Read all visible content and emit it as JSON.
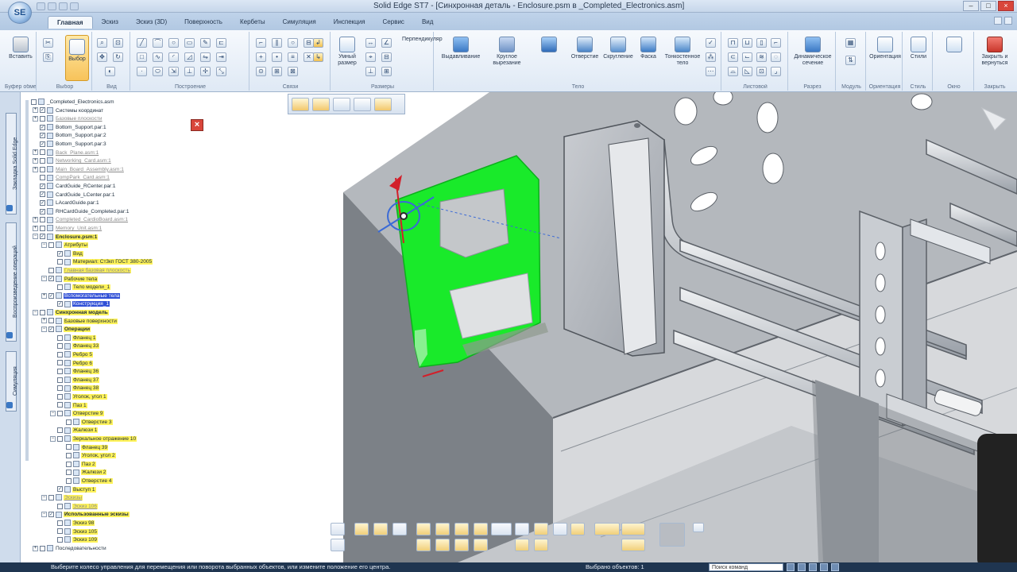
{
  "app": {
    "logo": "SE",
    "window_title": "Solid Edge ST7 - [Синхронная деталь - Enclosure.psm в _Completed_Electronics.asm]"
  },
  "tabs": [
    "Главная",
    "Эскиз",
    "Эскиз (3D)",
    "Поверхность",
    "Кербеты",
    "Симуляция",
    "Инспекция",
    "Сервис",
    "Вид"
  ],
  "ribbon": {
    "groups": [
      {
        "label": "Буфер обмена"
      },
      {
        "label": "Выбор"
      },
      {
        "label": "Вид"
      },
      {
        "label": "Построение"
      },
      {
        "label": "Связи"
      },
      {
        "label": "Размеры"
      },
      {
        "label": "Тело"
      },
      {
        "label": "Листовой"
      },
      {
        "label": "Разрез"
      },
      {
        "label": "Модуль"
      },
      {
        "label": "Ориентация"
      },
      {
        "label": "Стиль"
      },
      {
        "label": "Окно"
      },
      {
        "label": "Закрыть"
      }
    ],
    "buttons": {
      "paste": "Вставить",
      "select": "Выбор",
      "smart_dim": "Умный размер",
      "perp": "Перпендикуляр",
      "extrude": "Выдавливание",
      "cutout": "Круглое вырезание",
      "hole": "Отверстие",
      "thread": "Скругление",
      "chamfer": "Фаска",
      "thin": "Тонкостенное тело",
      "dyn_section": "Динамическое сечение",
      "orient": "Ориентация",
      "style": "Стили",
      "close_return": "Закрыть и вернуться"
    }
  },
  "sidebar_tabs": [
    "Закладка Solid Edge",
    "Воспроизведение операций",
    "Симуляция"
  ],
  "tree": [
    {
      "text": "_Completed_Electronics.asm",
      "level": 0,
      "ex": "",
      "cb": "",
      "style": ""
    },
    {
      "text": "Системы координат",
      "level": 1,
      "ex": "+",
      "cb": "✓",
      "style": ""
    },
    {
      "text": "Базовые плоскости",
      "level": 1,
      "ex": "+",
      "cb": "",
      "style": "gr"
    },
    {
      "text": "Bottom_Support.par:1",
      "level": 1,
      "ex": "",
      "cb": "✓",
      "style": ""
    },
    {
      "text": "Bottom_Support.par:2",
      "level": 1,
      "ex": "",
      "cb": "✓",
      "style": ""
    },
    {
      "text": "Bottom_Support.par:3",
      "level": 1,
      "ex": "",
      "cb": "✓",
      "style": ""
    },
    {
      "text": "Back_Plane.asm:1",
      "level": 1,
      "ex": "+",
      "cb": "",
      "style": "gr"
    },
    {
      "text": "Networking_Card.asm:1",
      "level": 1,
      "ex": "+",
      "cb": "",
      "style": "gr"
    },
    {
      "text": "Main_Board_Assembly.asm:1",
      "level": 1,
      "ex": "+",
      "cb": "",
      "style": "gr"
    },
    {
      "text": "CompPark_Card.asm:1",
      "level": 1,
      "ex": "",
      "cb": "",
      "style": "gr"
    },
    {
      "text": "CardGuide_RCenter.par:1",
      "level": 1,
      "ex": "",
      "cb": "✓",
      "style": ""
    },
    {
      "text": "CardGuide_LCenter.par:1",
      "level": 1,
      "ex": "",
      "cb": "✓",
      "style": ""
    },
    {
      "text": "LAcardGuide.par:1",
      "level": 1,
      "ex": "",
      "cb": "✓",
      "style": ""
    },
    {
      "text": "RHCardGuide_Completed.par:1",
      "level": 1,
      "ex": "",
      "cb": "✓",
      "style": ""
    },
    {
      "text": "Completed_CardioBoard.asm:1",
      "level": 1,
      "ex": "+",
      "cb": "",
      "style": "gr"
    },
    {
      "text": "Memory_Unit.asm:1",
      "level": 1,
      "ex": "+",
      "cb": "",
      "style": "gr"
    },
    {
      "text": "Enclosure.psm:1",
      "level": 1,
      "ex": "−",
      "cb": "✓",
      "style": "hl bold"
    },
    {
      "text": "Атрибуты",
      "level": 2,
      "ex": "−",
      "cb": "",
      "style": "hl"
    },
    {
      "text": "Вид",
      "level": 3,
      "ex": "",
      "cb": "✓",
      "style": "hl"
    },
    {
      "text": "Материал: Ст3кп ГОСТ 380-2005",
      "level": 3,
      "ex": "",
      "cb": "",
      "style": "hl"
    },
    {
      "text": "Главная базовая плоскость",
      "level": 2,
      "ex": "",
      "cb": "",
      "style": "hl gr"
    },
    {
      "text": "Рабочие тела",
      "level": 2,
      "ex": "−",
      "cb": "✓",
      "style": "hl"
    },
    {
      "text": "Тело модели_1",
      "level": 3,
      "ex": "",
      "cb": "",
      "style": "hl"
    },
    {
      "text": "Вспомогательные тела",
      "level": 2,
      "ex": "+",
      "cb": "✓",
      "style": "sel"
    },
    {
      "text": "Конструкция_1",
      "level": 3,
      "ex": "",
      "cb": "✓",
      "style": "sel"
    },
    {
      "text": "Синхронная модель",
      "level": 1,
      "ex": "−",
      "cb": "",
      "style": "hl bold"
    },
    {
      "text": "Базовые поверхности",
      "level": 2,
      "ex": "+",
      "cb": "",
      "style": "hl"
    },
    {
      "text": "Операции",
      "level": 2,
      "ex": "−",
      "cb": "✓",
      "style": "hl bold"
    },
    {
      "text": "Фланец 1",
      "level": 3,
      "ex": "",
      "cb": "",
      "style": "hl"
    },
    {
      "text": "Фланец 33",
      "level": 3,
      "ex": "",
      "cb": "",
      "style": "hl"
    },
    {
      "text": "Ребро 5",
      "level": 3,
      "ex": "",
      "cb": "",
      "style": "hl"
    },
    {
      "text": "Ребро 6",
      "level": 3,
      "ex": "",
      "cb": "",
      "style": "hl"
    },
    {
      "text": "Фланец 36",
      "level": 3,
      "ex": "",
      "cb": "",
      "style": "hl"
    },
    {
      "text": "Фланец 37",
      "level": 3,
      "ex": "",
      "cb": "",
      "style": "hl"
    },
    {
      "text": "Фланец 38",
      "level": 3,
      "ex": "",
      "cb": "",
      "style": "hl"
    },
    {
      "text": "Уголок, угол 1",
      "level": 3,
      "ex": "",
      "cb": "",
      "style": "hl"
    },
    {
      "text": "Паз 1",
      "level": 3,
      "ex": "",
      "cb": "",
      "style": "hl"
    },
    {
      "text": "Отверстие 9",
      "level": 3,
      "ex": "−",
      "cb": "",
      "style": "hl"
    },
    {
      "text": "Отверстие 3",
      "level": 4,
      "ex": "",
      "cb": "",
      "style": "hl"
    },
    {
      "text": "Жалюзи 1",
      "level": 3,
      "ex": "",
      "cb": "",
      "style": "hl"
    },
    {
      "text": "Зеркальное отражение 10",
      "level": 3,
      "ex": "−",
      "cb": "",
      "style": "hl"
    },
    {
      "text": "Фланец 39",
      "level": 4,
      "ex": "",
      "cb": "",
      "style": "hl"
    },
    {
      "text": "Уголок, угол 2",
      "level": 4,
      "ex": "",
      "cb": "",
      "style": "hl"
    },
    {
      "text": "Паз 2",
      "level": 4,
      "ex": "",
      "cb": "",
      "style": "hl"
    },
    {
      "text": "Жалюзи 2",
      "level": 4,
      "ex": "",
      "cb": "",
      "style": "hl"
    },
    {
      "text": "Отверстие 4",
      "level": 4,
      "ex": "",
      "cb": "",
      "style": "hl"
    },
    {
      "text": "Выступ 1",
      "level": 3,
      "ex": "",
      "cb": "✓",
      "style": "hl"
    },
    {
      "text": "Эскизы",
      "level": 2,
      "ex": "−",
      "cb": "",
      "style": "hl gr"
    },
    {
      "text": "Эскиз 106",
      "level": 3,
      "ex": "",
      "cb": "",
      "style": "hl gr"
    },
    {
      "text": "Использованные эскизы",
      "level": 2,
      "ex": "−",
      "cb": "✓",
      "style": "hl bold"
    },
    {
      "text": "Эскиз 98",
      "level": 3,
      "ex": "",
      "cb": "",
      "style": "hl"
    },
    {
      "text": "Эскиз 105",
      "level": 3,
      "ex": "",
      "cb": "",
      "style": "hl"
    },
    {
      "text": "Эскиз 109",
      "level": 3,
      "ex": "",
      "cb": "",
      "style": "hl"
    },
    {
      "text": "Последовательности",
      "level": 1,
      "ex": "+",
      "cb": "",
      "style": ""
    }
  ],
  "status": {
    "message": "Выберите колесо управления для перемещения или поворота выбранных объектов, или измените положение его центра.",
    "selected": "Выбрано объектов: 1",
    "search_placeholder": "Поиск команд"
  },
  "colors": {
    "selection_green": "#19ea2a",
    "highlight_yellow": "#fff35a",
    "close_red": "#d9463b"
  }
}
